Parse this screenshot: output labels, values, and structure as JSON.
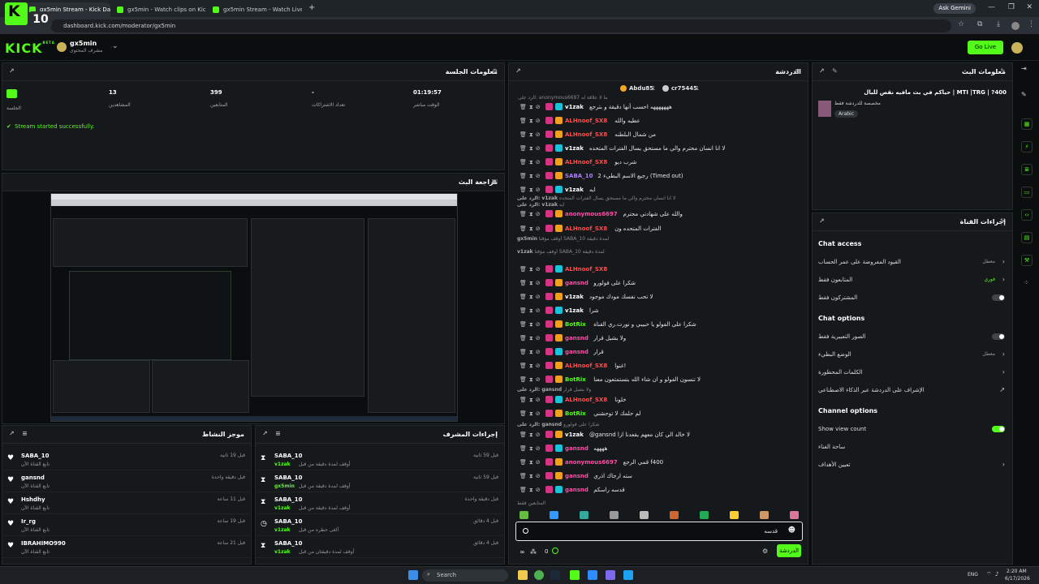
{
  "browser": {
    "tabs": [
      {
        "title": "gx5min Stream - Kick Dashboa"
      },
      {
        "title": "gx5min - Watch clips on Kick"
      },
      {
        "title": "gx5min Stream - Watch Live or"
      }
    ],
    "url": "dashboard.kick.com/moderator/gx5min",
    "gemini": "Ask Gemini",
    "overlay_number": "10"
  },
  "header": {
    "logo": "KICK",
    "logo_sup": "BETA",
    "channel": "gx5min",
    "channel_sub": "مشرف المحتوى",
    "go_live": "Go Live"
  },
  "session": {
    "title": "معلومات الجلسة",
    "stats": [
      {
        "value": "01:19:57",
        "label": "الوقت مباشر"
      },
      {
        "value": "-",
        "label": "تعداد الاشتراكات"
      },
      {
        "value": "399",
        "label": "المتابعين"
      },
      {
        "value": "13",
        "label": "المشاهدين"
      }
    ],
    "live_label": "الجلسة",
    "message": "Stream started successfully."
  },
  "preview": {
    "title": "مراجعة البث"
  },
  "activity": {
    "title": "موجز النشاط",
    "items": [
      {
        "user": "SABA_10",
        "sub": "تابع القناة الآن",
        "time": "قبل 19 ثانية"
      },
      {
        "user": "gansnd",
        "sub": "تابع القناة الآن",
        "time": "قبل دقيقة واحدة"
      },
      {
        "user": "Hshdhy",
        "sub": "تابع القناة الآن",
        "time": "قبل 11 ساعة"
      },
      {
        "user": "Ir_rg",
        "sub": "تابع القناة الآن",
        "time": "قبل 19 ساعة"
      },
      {
        "user": "IBRAHIMO990",
        "sub": "تابع القناة الآن",
        "time": "قبل 21 ساعة"
      }
    ]
  },
  "modactions": {
    "title": "إجراءات المشرف",
    "items": [
      {
        "user": "SABA_10",
        "action": "أوقف لمدة دقيقة من قبل",
        "by": "v1zak",
        "time": "قبل 59 ثانية"
      },
      {
        "user": "SABA_10",
        "action": "أوقف لمدة دقيقة من قبل",
        "by": "gx5min",
        "time": "قبل 59 ثانية"
      },
      {
        "user": "SABA_10",
        "action": "أوقف لمدة دقيقة من قبل",
        "by": "v1zak",
        "time": "قبل دقيقة واحدة"
      },
      {
        "user": "SABA_10",
        "action": "ألغى حظره من قبل",
        "by": "v1zak",
        "time": "قبل 4 دقائق"
      },
      {
        "user": "SABA_10",
        "action": "أوقف لمدة دقيقتان من قبل",
        "by": "v1zak",
        "time": "قبل 4 دقائق"
      }
    ]
  },
  "chat": {
    "title": "الدردشة",
    "top_users": [
      {
        "name": "Abdu85",
        "count": "1"
      },
      {
        "name": "cr75445",
        "count": "1"
      }
    ],
    "reply_note": "الرد على: anonymous6697 ما لا علاقة له",
    "lines": [
      {
        "user": "v1zak",
        "color": "#ffffff",
        "msg": "هههههههه احسب أنها دقيقة و بترجع"
      },
      {
        "user": "ALHnoof_SX8",
        "color": "#ff4d4d",
        "msg": "عطيه والله"
      },
      {
        "user": "ALHnoof_SX8",
        "color": "#ff4d4d",
        "msg": "من شمال البلطنه"
      },
      {
        "user": "v1zak",
        "color": "#ffffff",
        "msg": "لا انا انسان محترم والي ما مستحق يسال الفترات المتحده"
      },
      {
        "user": "ALHnoof_SX8",
        "color": "#ff4d4d",
        "msg": "شرب ديو"
      },
      {
        "user": "SABA_10",
        "color": "#b07cff",
        "msg": "رجيع الاسم البطيء 2 (Timed out)"
      },
      {
        "user": "v1zak",
        "color": "#ffffff",
        "msg": "ايه"
      },
      {
        "user": "anonymous6697",
        "color": "#ff4da6",
        "msg": "والله على شهادتي محترم"
      },
      {
        "user": "ALHnoof_SX8",
        "color": "#ff4d4d",
        "msg": "الفترات المتحده ون"
      },
      {
        "user": "ALHnoof_SX8",
        "color": "#ff4d4d",
        "msg": ""
      },
      {
        "user": "gansnd",
        "color": "#ff4da6",
        "msg": "شكرا على فولورو"
      },
      {
        "user": "v1zak",
        "color": "#ffffff",
        "msg": "لا تحب نفسك مودك موجود"
      },
      {
        "user": "v1zak",
        "color": "#ffffff",
        "msg": "شرا"
      },
      {
        "user": "BotRix",
        "color": "#53fc18",
        "msg": "شكرا على الفولو يا حبيبي و نورت.ري القناة"
      },
      {
        "user": "gansnd",
        "color": "#ff4da6",
        "msg": "ولا بشيل قرار"
      },
      {
        "user": "gansnd",
        "color": "#ff4da6",
        "msg": "قرار"
      },
      {
        "user": "ALHnoof_SX8",
        "color": "#ff4d4d",
        "msg": "غنوا!"
      },
      {
        "user": "BotRix",
        "color": "#53fc18",
        "msg": "لا تنسون الفولو و ان شاء الله بتستمتعون معنا"
      },
      {
        "user": "ALHnoof_SX8",
        "color": "#ff4d4d",
        "msg": "خلونا"
      },
      {
        "user": "BotRix",
        "color": "#53fc18",
        "msg": "لم حلمك لا توحشني"
      },
      {
        "user": "v1zak",
        "color": "#ffffff",
        "msg": "@gansnd لا خالد الي كان معهم يقعدنا ازا"
      },
      {
        "user": "gansnd",
        "color": "#ff4da6",
        "msg": "ههههه"
      },
      {
        "user": "anonymous6697",
        "color": "#ff4da6",
        "msg": "قمي الرجع f400"
      },
      {
        "user": "gansnd",
        "color": "#ff4da6",
        "msg": "سته ارجاك اذري"
      },
      {
        "user": "gansnd",
        "color": "#ff4da6",
        "msg": "قدسه راسكم"
      }
    ],
    "sys_lines": [
      {
        "text": "لا انا انسان محترم والي ما مستحق يسال الفترات المتحده",
        "pre": "الرد على: v1zak"
      },
      {
        "text": "ايه",
        "pre": "الرد على: v1zak"
      },
      {
        "text": "أوقف مؤقتاً SABA_10 لمدة دقيقة",
        "pre": "gx5min"
      },
      {
        "text": "أوقف مؤقتاً SABA_10 لمدة دقيقة",
        "pre": "v1zak"
      },
      {
        "text": "ولا بشيل قرار",
        "pre": "الرد على: gansnd"
      },
      {
        "text": "شكرا على فولورو",
        "pre": "الرد على: gansnd"
      }
    ],
    "followers_only": "المتابعين فقط",
    "input_value": "قدسه",
    "send": "الدردشة",
    "count": "0"
  },
  "stream_info": {
    "title": "معلومات البث",
    "stream_title": "400? | MTI |TRG | حياكم في بث مافيه نقص للبال",
    "category": "مخصصة للدردشة فقط",
    "language": "Arabic"
  },
  "channel_actions": {
    "title": "إجراءات القناة",
    "sections": [
      {
        "name": "Chat access",
        "rows": [
          {
            "label": "القيود المفروضة على عمر الحساب",
            "value": "معطل",
            "ctrl": "chev"
          },
          {
            "label": "المتابعون فقط",
            "value": "فوري",
            "ctrl": "chev"
          },
          {
            "label": "المشتركون فقط",
            "value": "",
            "ctrl": "toggle-off"
          }
        ]
      },
      {
        "name": "Chat options",
        "rows": [
          {
            "label": "الصور التعبيرية فقط",
            "value": "",
            "ctrl": "toggle-off"
          },
          {
            "label": "الوضع البطيء",
            "value": "معطل",
            "ctrl": "chev"
          },
          {
            "label": "الكلمات المحظورة",
            "value": "",
            "ctrl": "chev"
          },
          {
            "label": "الإشراف على الدردشة عبر الذكاء الاصطناعي",
            "value": "",
            "ctrl": "ext"
          }
        ]
      },
      {
        "name": "Channel options",
        "rows": [
          {
            "label": "Show view count",
            "value": "",
            "ctrl": "toggle-on"
          },
          {
            "label": "ساحة الغناء",
            "value": "",
            "ctrl": "none"
          },
          {
            "label": "تعيين الأهداف",
            "value": "",
            "ctrl": "chev"
          }
        ]
      }
    ]
  },
  "taskbar": {
    "search": "Search",
    "time": "2:20 AM",
    "date": "6/17/2026",
    "lang": "ENG"
  },
  "colors": {
    "accent": "#53fc18",
    "panel": "#15191c",
    "bg": "#0b0e0f"
  }
}
